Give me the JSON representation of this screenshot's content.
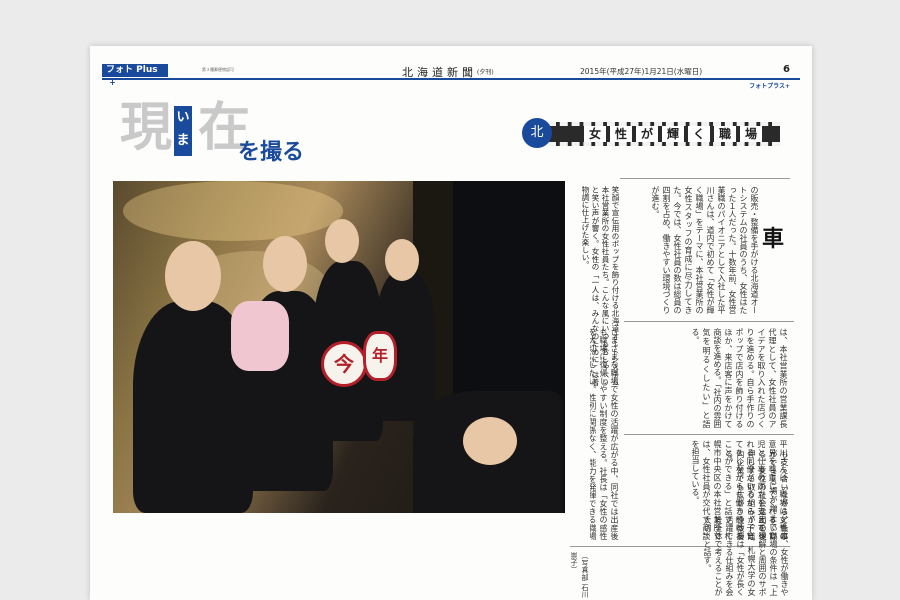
{
  "masthead": {
    "section_tab": "フォト Plus",
    "tiny_note": "第３種郵便物認可",
    "paper_name": "北海道新聞",
    "paper_edition": "(夕刊)",
    "date": "2015年(平成27年)1月21日(水曜日)",
    "page_number": "6",
    "corner_label": "フォトプラス+"
  },
  "headline": {
    "kanji_1": "現",
    "ruby": [
      "い",
      "ま"
    ],
    "kanji_2": "在",
    "subtitle": "を撮る"
  },
  "theme": {
    "badge": "北",
    "cells": [
      "女",
      "性",
      "が",
      "輝",
      "く",
      "職",
      "場"
    ]
  },
  "photo": {
    "sign_1": "今",
    "sign_2": "年"
  },
  "caption": "笑顔で宣伝用のポップを飾り付ける北海道オートシステム本社営業所の女性社員たち。こんな風にいつもおしゃべりと笑い声が響く。女性の「一人は、みんなのために」は着物調に仕上げた楽しい。",
  "article": {
    "lead_character": "車",
    "col_a": "の販売・整備を手がける北海道オートシステムの社員のうち、女性はたった１人だった。十数年前、女性営業職のパイオニアとして入社した平川さんは、道内で初めて「女性が輝く職場」をテーマに、本社営業所の女性スタッフの育成に尽力してきた。今では、女性社員の数は総員の四割を占め、働きやすい環境づくりが進む。",
    "col_b": "は、本社営業所の営業課長代理として、女性社員のアイデアを取り入れた店づくりを進める。自ら手作りのポップで店内を飾り付けるほか、来店客に声をかけて商談を進める。「社内の雰囲気を明るくしたい」と語る。",
    "col_c": "平川さんは「職場は女性の意見を尊重してくれる。育児と仕事の両立を支えてくれる同僚がいるから、子育てをしながらも働き続けることができる」と話す。札幌市中央区の本社営業所では、女性社員が交代で商談を担当している。",
    "col_d": "さまざまな職場で女性の活躍が広がる中、同社では出産後も職場に復帰しやすい制度を整える。社長は「女性の感性を大切にしたい。性別に関係なく、能力を発揮できる職場にしたい」と力を込める。",
    "col_e": "も支え合いながら、仕事ができる場が増えている。女性の社会進出を後押しする取り組みが、道内企業でも広がりつつある。",
    "col_f": "ともに、女性が働きやすい職場の条件は「上司の理解と周囲のサポート」。札幌大学の女性教授は「女性が長く活躍できる仕組みを会社全体で考えることが大切」と話す。",
    "col_g": "（写真部 石川崇子）"
  }
}
